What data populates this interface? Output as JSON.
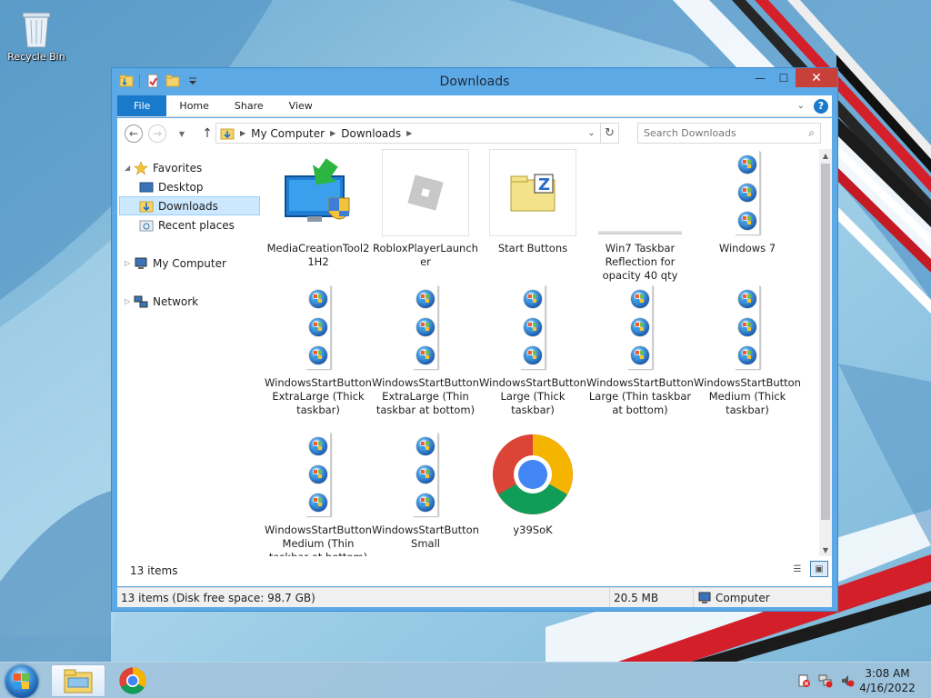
{
  "desktop": {
    "recycle_bin_label": "Recycle Bin"
  },
  "window": {
    "title": "Downloads",
    "controls": {
      "minimize": "—",
      "maximize": "☐",
      "close": "✕"
    }
  },
  "ribbon": {
    "tabs": [
      "File",
      "Home",
      "Share",
      "View"
    ]
  },
  "navbar": {
    "breadcrumb": [
      "My Computer",
      "Downloads"
    ],
    "search_placeholder": "Search Downloads"
  },
  "navpane": {
    "favorites": "Favorites",
    "desktop": "Desktop",
    "downloads": "Downloads",
    "recent": "Recent places",
    "my_computer": "My Computer",
    "network": "Network"
  },
  "files": [
    {
      "name": "MediaCreationTool21H2",
      "icon": "media-creation-tool-icon"
    },
    {
      "name": "RobloxPlayerLauncher",
      "icon": "roblox-icon"
    },
    {
      "name": "Start Buttons",
      "icon": "zip-folder-icon"
    },
    {
      "name": "Win7 Taskbar Reflection for opacity 40 qty",
      "icon": "taskbar-strip-icon"
    },
    {
      "name": "Windows 7",
      "icon": "start-orb-strip-icon"
    },
    {
      "name": "WindowsStartButtonExtraLarge (Thick taskbar)",
      "icon": "start-orb-strip-icon"
    },
    {
      "name": "WindowsStartButtonExtraLarge (Thin taskbar at bottom)",
      "icon": "start-orb-strip-icon"
    },
    {
      "name": "WindowsStartButtonLarge (Thick taskbar)",
      "icon": "start-orb-strip-icon"
    },
    {
      "name": "WindowsStartButtonLarge (Thin taskbar at bottom)",
      "icon": "start-orb-strip-icon"
    },
    {
      "name": "WindowsStartButtonMedium (Thick taskbar)",
      "icon": "start-orb-strip-icon"
    },
    {
      "name": "WindowsStartButtonMedium (Thin taskbar at bottom)",
      "icon": "start-orb-strip-icon"
    },
    {
      "name": "WindowsStartButtonSmall",
      "icon": "start-orb-strip-icon"
    },
    {
      "name": "y39SoK",
      "icon": "chrome-icon"
    }
  ],
  "footer": {
    "item_count": "13 items"
  },
  "statusbar": {
    "summary": "13 items (Disk free space: 98.7 GB)",
    "size": "20.5 MB",
    "location": "Computer"
  },
  "taskbar": {
    "time": "3:08 AM",
    "date": "4/16/2022"
  },
  "colors": {
    "accent": "#1979ca",
    "close_button": "#c7403a",
    "window_frame": "#5da9e6",
    "selection": "#cce8ff"
  }
}
